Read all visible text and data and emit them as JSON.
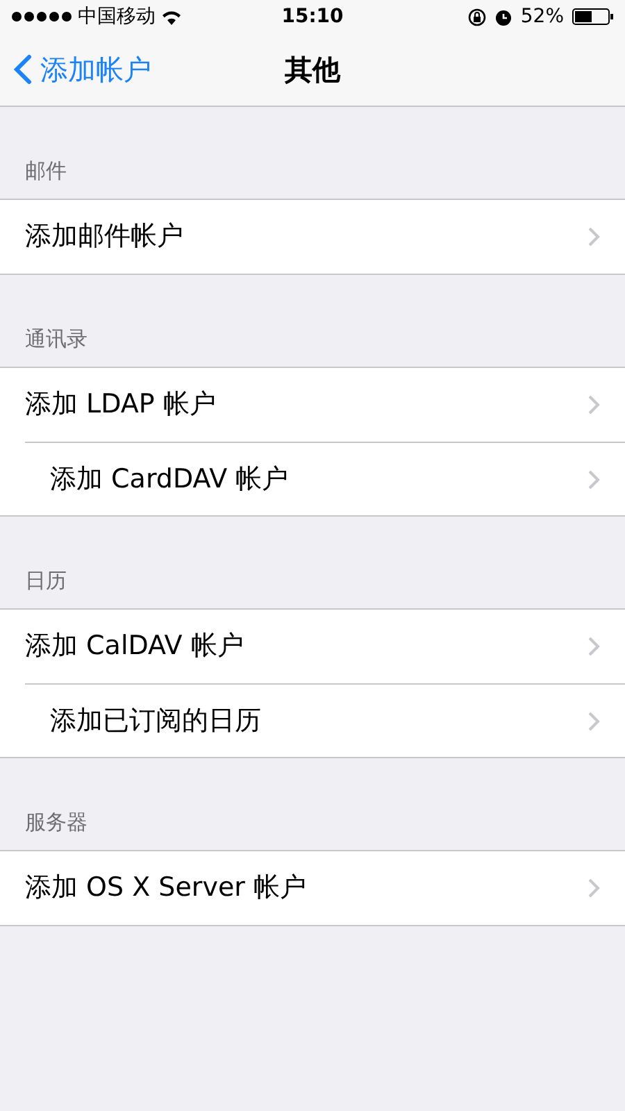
{
  "status_bar": {
    "carrier": "中国移动",
    "time": "15:10",
    "battery": "52%"
  },
  "nav_bar": {
    "back": "添加帐户",
    "title": "其他"
  },
  "sections": [
    {
      "header": "邮件",
      "rows": [
        {
          "label": "添加邮件帐户"
        }
      ]
    },
    {
      "header": "通讯录",
      "rows": [
        {
          "label": "添加 LDAP 帐户"
        },
        {
          "label": "添加 CardDAV 帐户"
        }
      ]
    },
    {
      "header": "日历",
      "rows": [
        {
          "label": "添加 CalDAV 帐户"
        },
        {
          "label": "添加已订阅的日历"
        }
      ]
    },
    {
      "header": "服务器",
      "rows": [
        {
          "label": "添加 OS X Server 帐户"
        }
      ]
    }
  ]
}
